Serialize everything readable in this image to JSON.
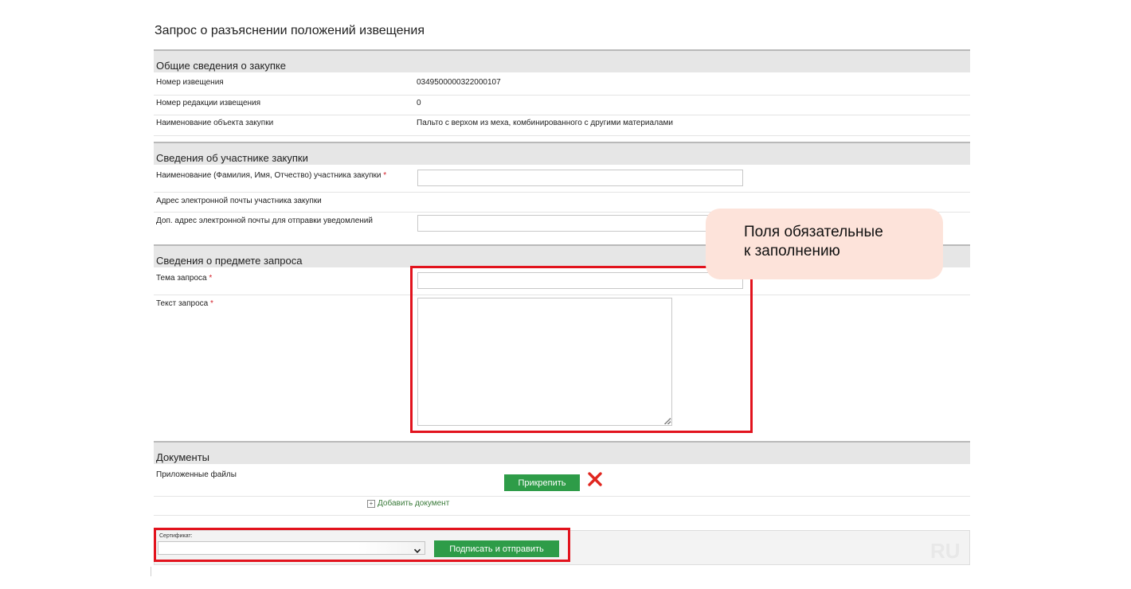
{
  "page_title": "Запрос о разъяснении положений извещения",
  "sections": {
    "general": {
      "title": "Общие сведения о закупке",
      "rows": [
        {
          "label": "Номер извещения",
          "value": "0349500000322000107"
        },
        {
          "label": "Номер редакции извещения",
          "value": "0"
        },
        {
          "label": "Наименование объекта закупки",
          "value": "Пальто с верхом из меха, комбинированного с другими материалами"
        }
      ]
    },
    "participant": {
      "title": "Сведения об участнике закупки",
      "name_label": "Наименование (Фамилия, Имя, Отчество) участника закупки",
      "name_value": "",
      "email_label": "Адрес электронной почты участника закупки",
      "extra_email_label": "Доп. адрес электронной почты для отправки уведомлений",
      "extra_email_value": ""
    },
    "subject": {
      "title": "Сведения о предмете запроса",
      "topic_label": "Тема запроса",
      "topic_value": "",
      "text_label": "Текст запроса",
      "text_value": ""
    },
    "documents": {
      "title": "Документы",
      "files_label": "Приложенные файлы",
      "attach_button": "Прикрепить",
      "add_document_link": "Добавить документ"
    }
  },
  "required_mark": "*",
  "certificate": {
    "label": "Сертификат:",
    "selected": "",
    "submit_button": "Подписать и отправить"
  },
  "watermark": "RU",
  "callout": {
    "line1": "Поля обязательные",
    "line2": "к заполнению"
  },
  "colors": {
    "header_bg": "#e6e6e6",
    "button_green": "#2e9c48",
    "highlight_red": "#e2131d",
    "callout_bg": "#fde3da",
    "required_red": "#d4202a"
  },
  "icons": [
    "delete-x-icon",
    "plus-box-icon",
    "chevron-down-icon"
  ]
}
